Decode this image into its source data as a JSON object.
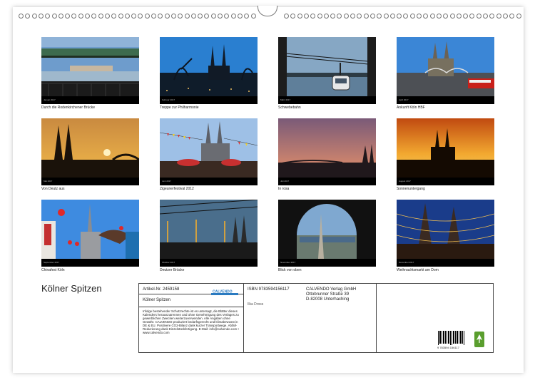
{
  "calendar": {
    "title": "Kölner Spitzen",
    "tiles": [
      {
        "caption": "Durch die Rodenkirchener Brücke",
        "month": "Januar 2017"
      },
      {
        "caption": "Treppe zur Philharmonie",
        "month": "Februar 2017"
      },
      {
        "caption": "Schwebebahn",
        "month": "März 2017"
      },
      {
        "caption": "Ankunft Köln HBF",
        "month": "April 2017"
      },
      {
        "caption": "Von Deutz aus",
        "month": "Mai 2017"
      },
      {
        "caption": "Zigeunerfestival 2012",
        "month": "Juni 2017"
      },
      {
        "caption": "In rosa",
        "month": "Juli 2017"
      },
      {
        "caption": "Sonnenuntergang",
        "month": "August 2017"
      },
      {
        "caption": "Chinafest Köln",
        "month": "September 2017"
      },
      {
        "caption": "Deutzer Brücke",
        "month": "Oktober 2017"
      },
      {
        "caption": "Blick von oben",
        "month": "November 2017"
      },
      {
        "caption": "Weihnachtsmarkt am Dom",
        "month": "Dezember 2017"
      }
    ]
  },
  "info": {
    "article": "Artikel-Nr. 2459158",
    "logo_text": "CALVENDO",
    "product_title": "Kölner Spitzen",
    "isbn": "ISBN 9783594156117",
    "publisher_name": "CALVENDO Verlag GmbH",
    "publisher_street": "Ottobrunner Straße 39",
    "publisher_city": "D-82008 Unterhaching",
    "author": "Ilka Dross",
    "legal_text": "Infolge bestehender Schutzrechte ist es untersagt, die Blätter dieses Kalenders herauszutrennen und ohne Genehmigung des Verlages zu gewerblichen Zwecken weiterzuverwenden. Alle Angaben ohne Gewähr. CALVENDO produziert bedarfsgerecht und klimabewusst in DE & EU. Positivere CO2-Bilanz dank kurzer Transportwege. Abfall-Reduzierung dank Einzelstückfertigung. E-Mail: info@calvendo.com • www.calvendo.com",
    "barcode_number": "9 783594 156117"
  }
}
